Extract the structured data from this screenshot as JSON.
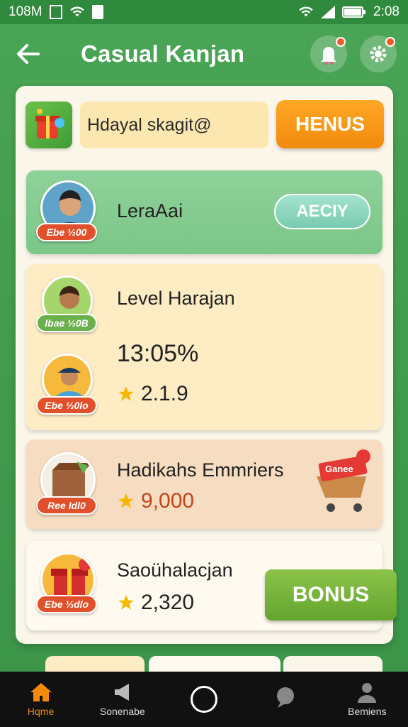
{
  "status_bar": {
    "left_text": "108M",
    "time": "2:08"
  },
  "header": {
    "title": "Casual Kanjan"
  },
  "top_row": {
    "search_value": "Hdayal skagit@",
    "menu_label": "HENUS"
  },
  "cards": [
    {
      "title": "LeraAai",
      "badge": "Ebe ⅓00",
      "button": "AECIY"
    },
    {
      "title": "Level Harajan",
      "badge_top": "Ibae ⅓0B",
      "value": "13:05%",
      "badge_bottom": "Ebe ⅓0lo",
      "rating": "2.1.9"
    },
    {
      "title": "Hadikahs Emmriers",
      "badge": "Ree Idl0",
      "rating": "9,000",
      "cart_label": "Ganee"
    },
    {
      "title": "Saoühalacjan",
      "badge": "Ebe ⅓dlo",
      "rating": "2,320",
      "button": "BONUS"
    }
  ],
  "nav": {
    "items": [
      {
        "label": "Hqme",
        "icon": "home-icon"
      },
      {
        "label": "Sonenabe",
        "icon": "megaphone-icon"
      },
      {
        "label": "",
        "icon": "home-circle-icon"
      },
      {
        "label": "",
        "icon": "chat-icon"
      },
      {
        "label": "Bemiens",
        "icon": "profile-icon"
      }
    ]
  },
  "colors": {
    "accent_orange": "#f28a0c",
    "accent_green": "#4aa556",
    "bonus_green": "#64a52f"
  }
}
